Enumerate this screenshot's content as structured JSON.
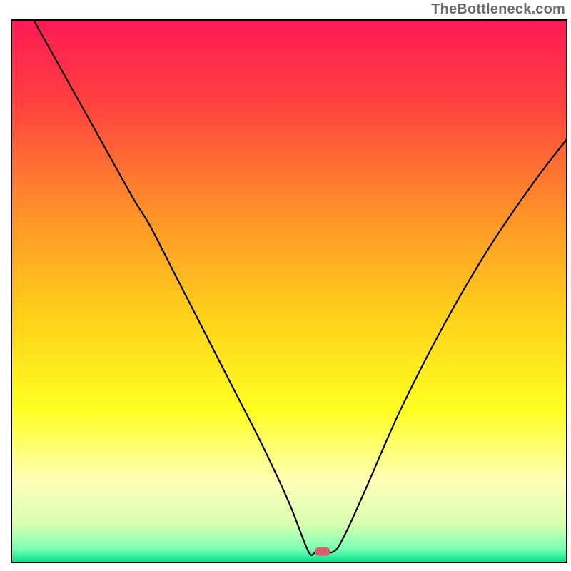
{
  "watermark": "TheBottleneck.com",
  "chart_data": {
    "type": "line",
    "title": "",
    "xlabel": "",
    "ylabel": "",
    "xlim": [
      0,
      100
    ],
    "ylim": [
      0,
      100
    ],
    "grid": false,
    "legend": false,
    "background_gradient": {
      "orientation": "vertical",
      "stops": [
        {
          "offset": 0.0,
          "color": "#ff1a55"
        },
        {
          "offset": 0.15,
          "color": "#ff4040"
        },
        {
          "offset": 0.35,
          "color": "#ff8f2a"
        },
        {
          "offset": 0.55,
          "color": "#ffd21a"
        },
        {
          "offset": 0.72,
          "color": "#ffff22"
        },
        {
          "offset": 0.85,
          "color": "#ffffb8"
        },
        {
          "offset": 0.93,
          "color": "#d8ffb0"
        },
        {
          "offset": 0.975,
          "color": "#7affb3"
        },
        {
          "offset": 1.0,
          "color": "#00e089"
        }
      ]
    },
    "marker": {
      "x": 56,
      "y": 2,
      "color": "#d9606a"
    },
    "series": [
      {
        "name": "curve",
        "color": "#000000",
        "x": [
          4,
          10,
          16,
          22,
          25,
          30,
          35,
          40,
          45,
          50,
          53.5,
          55,
          58,
          60,
          64,
          70,
          78,
          86,
          94,
          100
        ],
        "y": [
          100,
          89,
          78,
          67,
          62,
          52,
          42,
          32,
          22,
          11,
          2,
          2,
          2,
          5,
          14,
          28,
          44,
          58,
          70,
          78
        ]
      }
    ]
  }
}
